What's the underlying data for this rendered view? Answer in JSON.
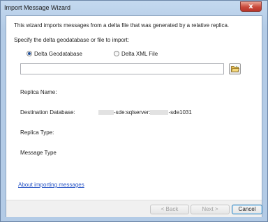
{
  "window": {
    "title": "Import Message Wizard",
    "close_glyph": "x"
  },
  "intro": "This wizard imports messages from a delta file that was generated by a relative replica.",
  "source_prompt": "Specify the delta geodatabase or file to import:",
  "options": [
    {
      "label": "Delta Geodatabase",
      "checked": true
    },
    {
      "label": "Delta XML File",
      "checked": false
    }
  ],
  "path_input": {
    "value": "",
    "placeholder": ""
  },
  "browse_icon": "open-folder-icon",
  "fields": {
    "replica_name": {
      "label": "Replica Name:",
      "value": ""
    },
    "destination_database": {
      "label": "Destination Database:",
      "value_part1": "-sde:sqlserver:",
      "value_part2": "-sde1031"
    },
    "replica_type": {
      "label": "Replica Type:",
      "value": ""
    },
    "message_type": {
      "label": "Message Type",
      "value": ""
    }
  },
  "help_link": "About importing messages",
  "buttons": {
    "back": "< Back",
    "next": "Next >",
    "cancel": "Cancel"
  },
  "colors": {
    "link": "#2a56c6",
    "accent": "#3c7fb1",
    "frame": "#b9d1ea"
  }
}
